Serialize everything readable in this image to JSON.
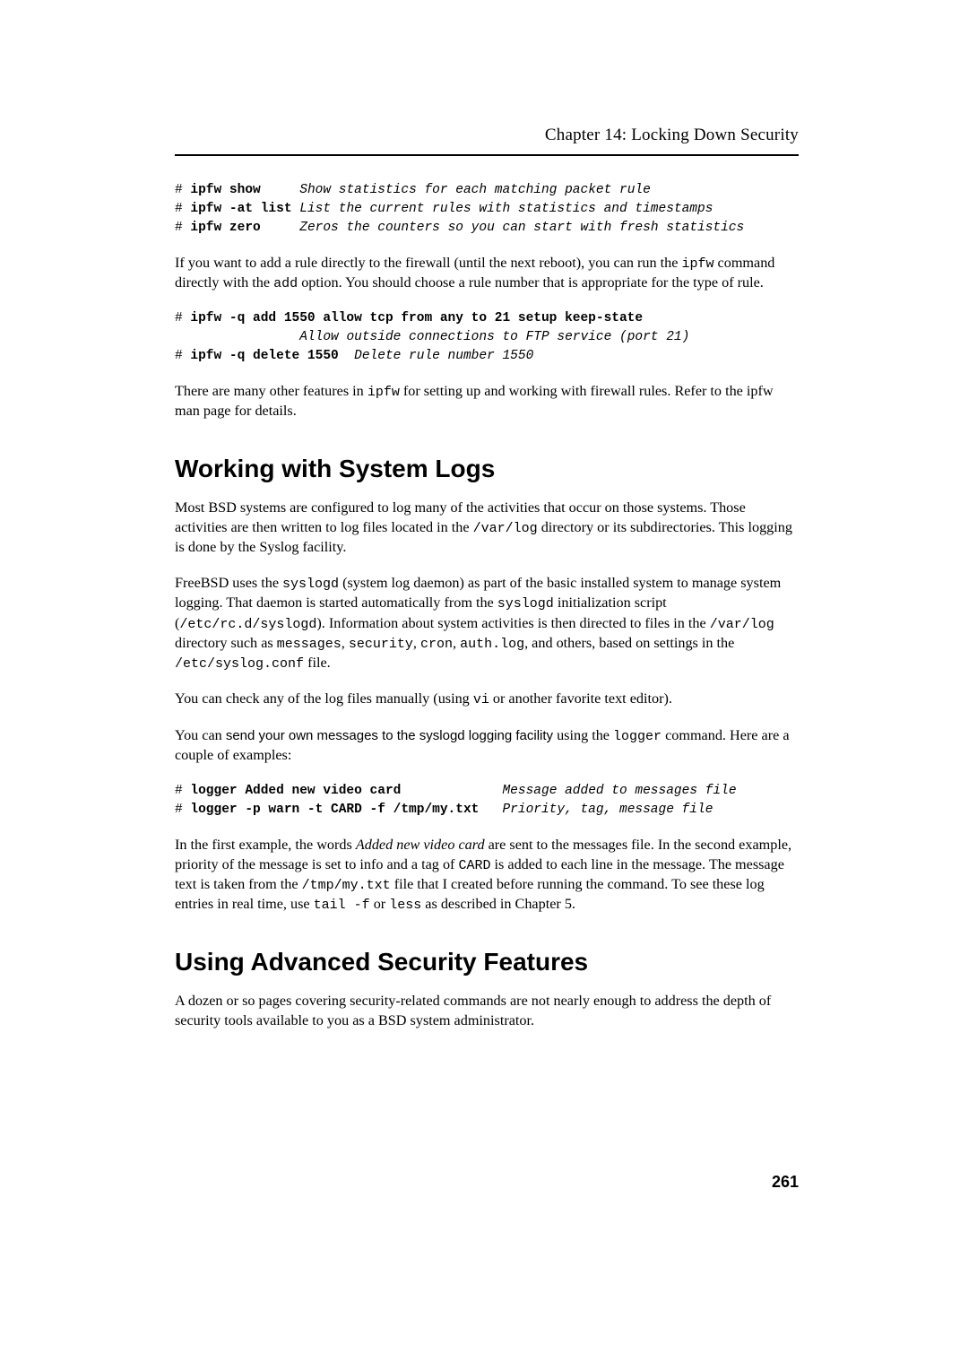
{
  "header": {
    "chapter_label": "Chapter 14: Locking Down Security"
  },
  "code1": {
    "line1_prompt": "# ",
    "line1_cmd": "ipfw show",
    "line1_pad": "     ",
    "line1_comment": "Show statistics for each matching packet rule",
    "line2_prompt": "# ",
    "line2_cmd": "ipfw -at list",
    "line2_pad": " ",
    "line2_comment": "List the current rules with statistics and timestamps",
    "line3_prompt": "# ",
    "line3_cmd": "ipfw zero",
    "line3_pad": "     ",
    "line3_comment": "Zeros the counters so you can start with fresh statistics"
  },
  "para1": {
    "t1": "If you want to add a rule directly to the firewall (until the next reboot), you can run the ",
    "c1": "ipfw",
    "t2": " command directly with the ",
    "c2": "add",
    "t3": " option. You should choose a rule number that is appropriate for the type of rule."
  },
  "code2": {
    "line1_prompt": "# ",
    "line1_cmd": "ipfw -q add 1550 allow tcp from any to 21 setup keep-state",
    "line2_pad": "                ",
    "line2_comment": "Allow outside connections to FTP service (port 21)",
    "line3_prompt": "# ",
    "line3_cmd": "ipfw -q delete 1550",
    "line3_pad": "  ",
    "line3_comment": "Delete rule number 1550"
  },
  "para2": {
    "t1": "There are many other features in ",
    "c1": "ipfw",
    "t2": " for setting up and working with firewall rules. Refer to the ipfw man page for details."
  },
  "heading1": "Working with System Logs",
  "para3": {
    "t1": "Most BSD systems are configured to log many of the activities that occur on those systems. Those activities are then written to log files located in the ",
    "c1": "/var/log",
    "t2": " directory or its subdirectories. This logging is done by the Syslog facility."
  },
  "para4": {
    "t1": "FreeBSD uses the ",
    "c1": "syslogd",
    "t2": " (system log daemon) as part of the basic installed system to manage system logging. That daemon is started automatically from the ",
    "c2": "syslogd",
    "t3": " initialization script (",
    "c3": "/etc/rc.d/syslogd",
    "t4": "). Information about system activities is then directed to files in the ",
    "c4": "/var/log",
    "t5": " directory such as ",
    "c5": "messages",
    "t6": ", ",
    "c6": "security",
    "t7": ", ",
    "c7": "cron",
    "t8": ", ",
    "c8": "auth.log",
    "t9": ", and others, based on settings in the ",
    "c9": "/etc/syslog.conf",
    "t10": " file."
  },
  "para5": {
    "t1": "You can check any of the log files manually (using ",
    "c1": "vi",
    "t2": " or another favorite text editor)."
  },
  "para6": {
    "t1": "You can ",
    "s1": "send your own messages to the syslogd logging facility",
    "t2": " using the ",
    "c1": "logger",
    "t3": " command. Here are a couple of examples:"
  },
  "code3": {
    "line1_prompt": "# ",
    "line1_cmd": "logger Added new video card",
    "line1_pad": "             ",
    "line1_comment": "Message added to messages file",
    "line2_prompt": "# ",
    "line2_cmd": "logger -p warn -t CARD -f /tmp/my.txt",
    "line2_pad": "   ",
    "line2_comment": "Priority, tag, message file"
  },
  "para7": {
    "t1": "In the first example, the words ",
    "i1": "Added new video card",
    "t2": " are sent to the messages file. In the second example, priority of the message is set to info and a tag of ",
    "c1": "CARD",
    "t3": " is added to each line in the message. The message text is taken from the ",
    "c2": "/tmp/my.txt",
    "t4": " file that I created before running the command. To see these log entries in real time, use ",
    "c3": "tail -f",
    "t5": " or ",
    "c4": "less",
    "t6": " as described in Chapter 5."
  },
  "heading2": "Using Advanced Security Features",
  "para8": {
    "t1": "A dozen or so pages covering security-related commands are not nearly enough to address the depth of security tools available to you as a BSD system administrator."
  },
  "page_number": "261"
}
